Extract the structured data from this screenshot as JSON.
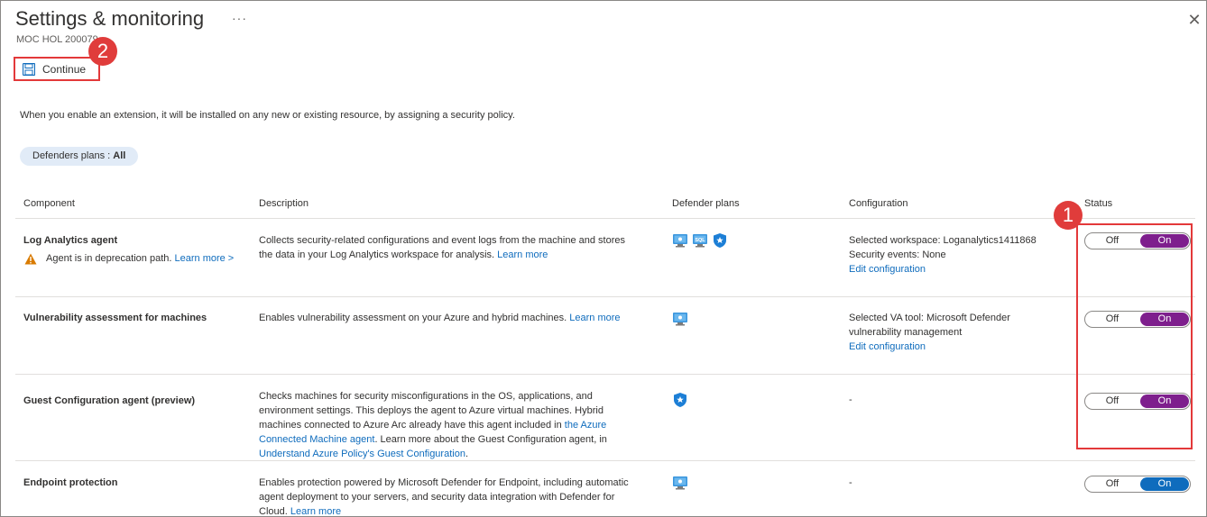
{
  "header": {
    "title": "Settings & monitoring",
    "more_label": "···",
    "subtitle": "MOC HOL 200079",
    "close_label": "✕"
  },
  "toolbar": {
    "continue_label": "Continue"
  },
  "callouts": {
    "first": "1",
    "second": "2"
  },
  "intro": "When you enable an extension, it will be installed on any new or existing resource, by assigning a security policy.",
  "filter": {
    "label": "Defenders plans : ",
    "value": "All"
  },
  "columns": [
    "Component",
    "Description",
    "Defender plans",
    "Configuration",
    "Status"
  ],
  "rows": [
    {
      "component": "Log Analytics agent",
      "warning": "Agent is in deprecation path.",
      "warning_link": "Learn more >",
      "description_lines": [
        "Collects security-related configurations and event logs from the machine and stores",
        "the data in your Log Analytics workspace for analysis."
      ],
      "description_link": "Learn more",
      "plans": [
        "server-icon",
        "sql-icon",
        "shield-icon"
      ],
      "config_lines": [
        "Selected workspace: Loganalytics1411868",
        "Security events: None"
      ],
      "config_link": "Edit configuration",
      "off_label": "Off",
      "on_label": "On",
      "state": "On"
    },
    {
      "component": "Vulnerability assessment for machines",
      "description_lines": [
        "Enables vulnerability assessment on your Azure and hybrid machines."
      ],
      "description_link": "Learn more",
      "plans": [
        "server-icon"
      ],
      "config_lines": [
        "Selected VA tool: Microsoft Defender",
        "vulnerability management"
      ],
      "config_link": "Edit configuration",
      "off_label": "Off",
      "on_label": "On",
      "state": "On"
    },
    {
      "component": "Guest Configuration agent (preview)",
      "description_lines": [
        "Checks machines for security misconfigurations in the OS, applications, and",
        "environment settings. This deploys the agent to Azure virtual machines. Hybrid",
        "machines connected to Azure Arc already have this agent included in",
        "Connected Machine agent",
        ". Learn more about the Guest Configuration agent, in",
        "Understand Azure Policy's Guest Configuration",
        "."
      ],
      "description_link": "the Azure",
      "plans": [
        "shield-icon"
      ],
      "config_lines": [
        "-"
      ],
      "off_label": "Off",
      "on_label": "On",
      "state": "On"
    },
    {
      "component": "Endpoint protection",
      "description_lines": [
        "Enables protection powered by Microsoft Defender for Endpoint, including automatic",
        "agent deployment to your servers, and security data integration with Defender for",
        "Cloud."
      ],
      "description_link": "Learn more",
      "plans": [
        "server-icon"
      ],
      "config_lines": [
        "-"
      ],
      "off_label": "Off",
      "on_label": "On",
      "state": "On"
    }
  ],
  "colors": {
    "accent": "#0f6cbd",
    "toggle_on_purple": "#7e1f8d",
    "callout": "#e3393a"
  }
}
